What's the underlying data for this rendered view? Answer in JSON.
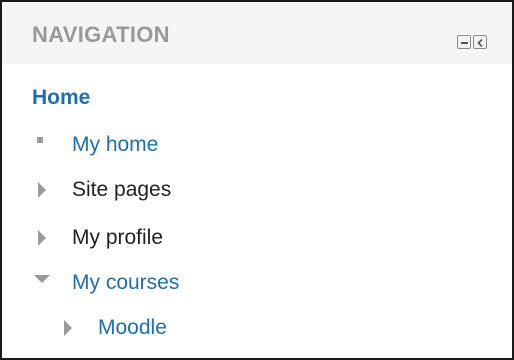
{
  "navigation": {
    "title": "NAVIGATION",
    "controls": [
      {
        "icon": "minimize-icon"
      },
      {
        "icon": "dock-left-icon"
      }
    ],
    "home_label": "Home",
    "items": [
      {
        "label": "My home",
        "marker": "square-bullet-icon",
        "style": "link"
      },
      {
        "label": "Site pages",
        "marker": "triangle-right-icon",
        "style": "plain"
      },
      {
        "label": "My profile",
        "marker": "triangle-right-icon",
        "style": "plain"
      },
      {
        "label": "My courses",
        "marker": "triangle-down-icon",
        "style": "link"
      },
      {
        "label": "Moodle",
        "marker": "triangle-right-icon",
        "style": "link"
      }
    ]
  },
  "colors": {
    "link": "#1e6fad",
    "title": "#999999",
    "header_bg": "#f5f5f5",
    "marker": "#9a9a9a"
  }
}
